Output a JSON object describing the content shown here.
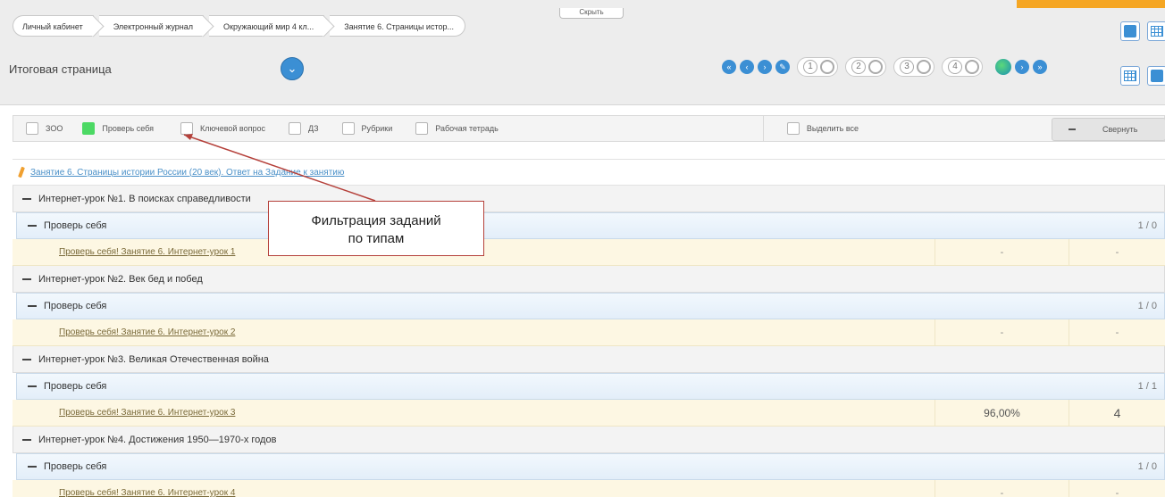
{
  "header": {
    "hide_label": "Скрыть",
    "breadcrumbs": [
      "Личный кабинет",
      "Электронный журнал",
      "Окружающий мир 4 кл...",
      "Занятие 6. Страницы истор..."
    ],
    "page_select": "Итоговая страница",
    "pages": [
      "1",
      "2",
      "3",
      "4"
    ]
  },
  "filters": {
    "items": [
      "ЗОО",
      "Проверь себя",
      "Ключевой вопрос",
      "ДЗ",
      "Рубрики",
      "Рабочая тетрадь"
    ],
    "checked": "Проверь себя",
    "select_all": "Выделить все",
    "collapse": "Свернуть"
  },
  "table": {
    "title_link": "Занятие 6. Страницы истории России (20 век). Ответ на Задание к занятию",
    "lessons": [
      {
        "title": "Интернет-урок №1. В поисках справедливости",
        "group": "Проверь себя",
        "count": "1 / 0",
        "task": "Проверь себя! Занятие 6. Интернет-урок 1",
        "score": "-",
        "grade": "-"
      },
      {
        "title": "Интернет-урок №2. Век бед и побед",
        "group": "Проверь себя",
        "count": "1 / 0",
        "task": "Проверь себя! Занятие 6. Интернет-урок 2",
        "score": "-",
        "grade": "-"
      },
      {
        "title": "Интернет-урок №3. Великая Отечественная война",
        "group": "Проверь себя",
        "count": "1 / 1",
        "task": "Проверь себя! Занятие 6. Интернет-урок 3",
        "score": "96,00%",
        "grade": "4"
      },
      {
        "title": "Интернет-урок №4. Достижения 1950—1970-х годов",
        "group": "Проверь себя",
        "count": "1 / 0",
        "task": "Проверь себя! Занятие 6. Интернет-урок 4",
        "score": "-",
        "grade": "-"
      }
    ]
  },
  "annotation": {
    "line1": "Фильтрация заданий",
    "line2": "по типам"
  }
}
